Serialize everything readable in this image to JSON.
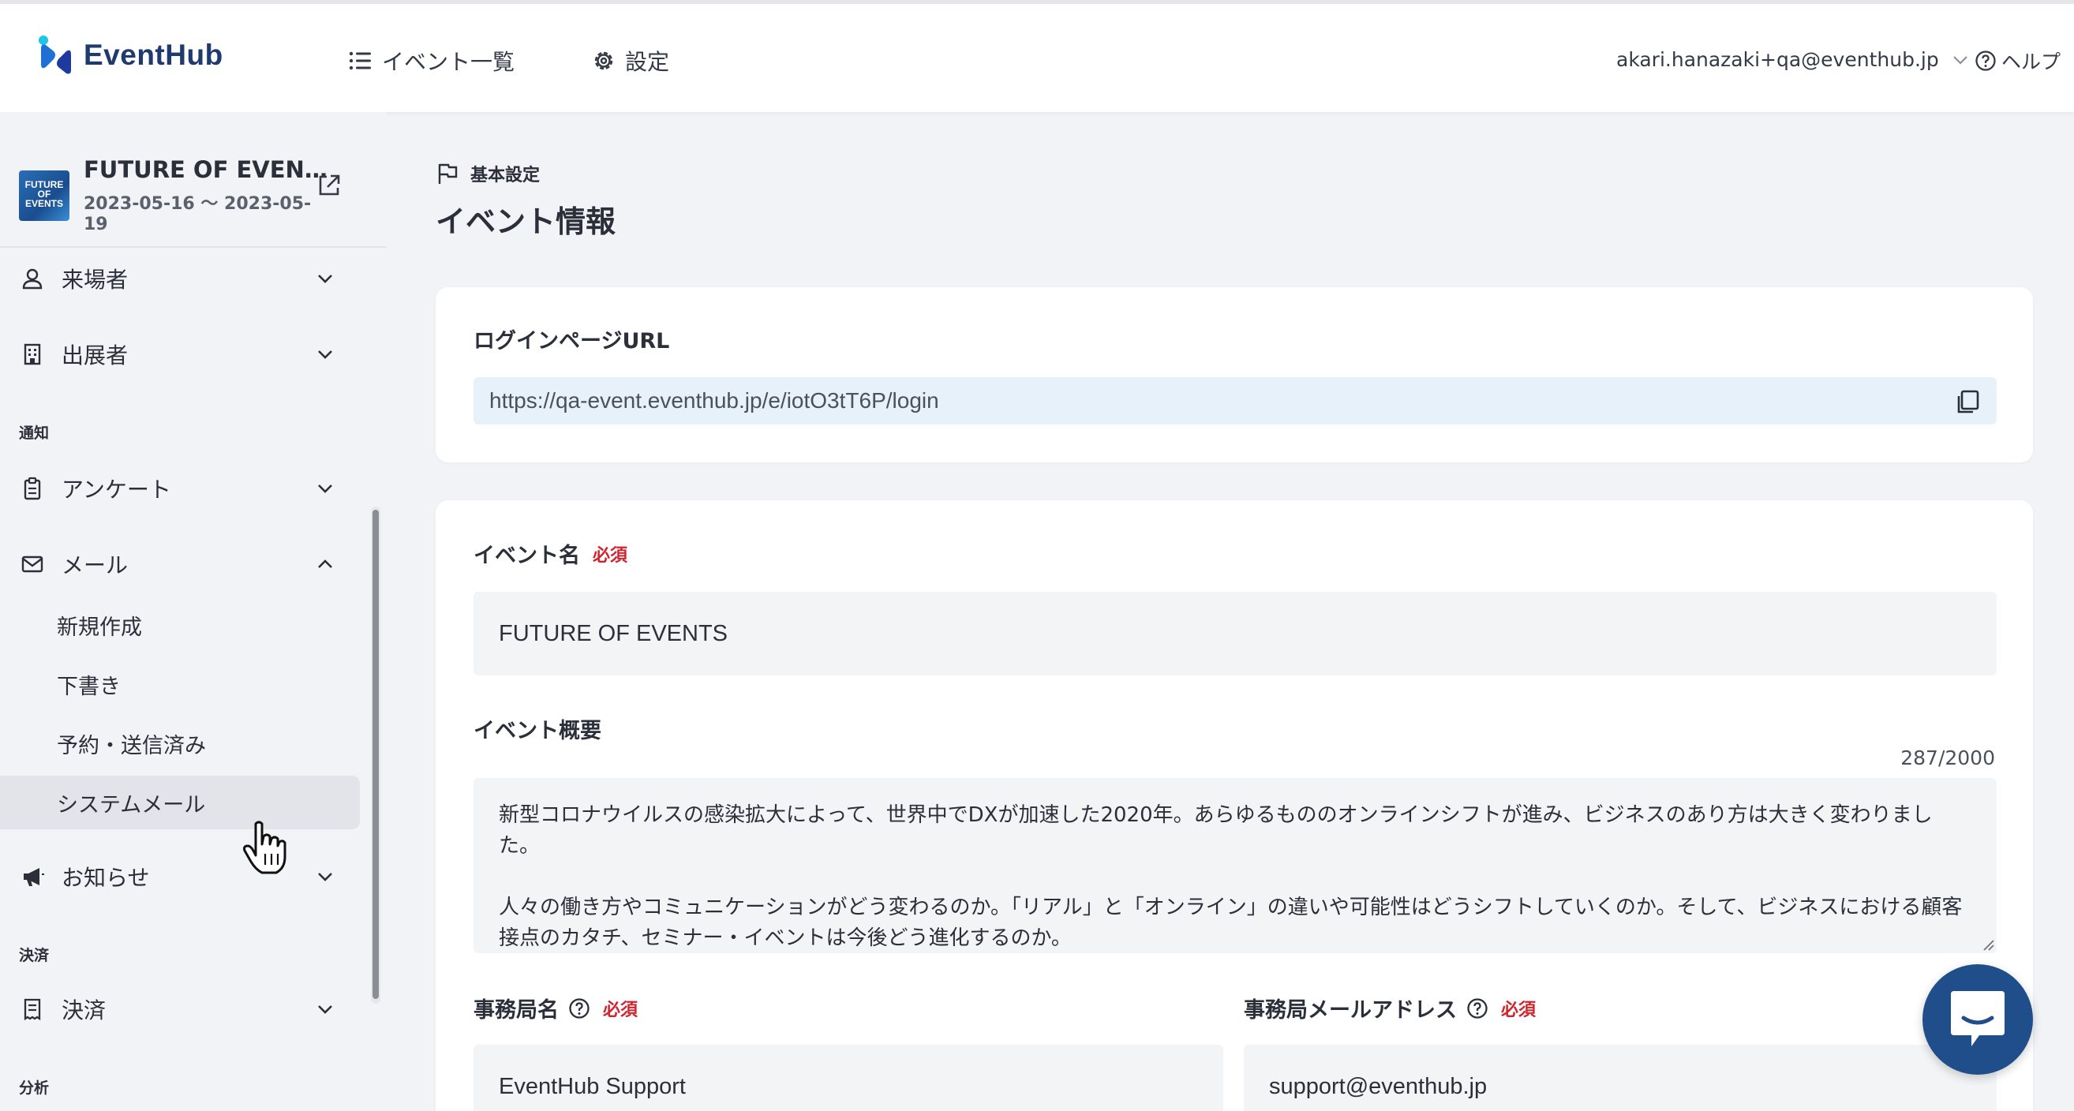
{
  "header": {
    "logo_text": "EventHub",
    "nav": [
      {
        "label": "イベント一覧",
        "icon": "list-icon"
      },
      {
        "label": "設定",
        "icon": "gear-icon"
      }
    ],
    "user_email": "akari.hanazaki+qa@eventhub.jp",
    "help_label": "ヘルプ"
  },
  "sidebar": {
    "event": {
      "thumb_text": "FUTURE OF EVENTS",
      "name": "FUTURE OF EVENTS",
      "dates": "2023-05-16 〜 2023-05-19"
    },
    "items": [
      {
        "label": "来場者",
        "icon": "person-icon",
        "expanded": false
      },
      {
        "label": "出展者",
        "icon": "building-icon",
        "expanded": false
      }
    ],
    "section_notice": "通知",
    "notice_items": [
      {
        "label": "アンケート",
        "icon": "clipboard-icon",
        "expanded": false
      },
      {
        "label": "メール",
        "icon": "mail-icon",
        "expanded": true
      }
    ],
    "mail_subitems": [
      "新規作成",
      "下書き",
      "予約・送信済み",
      "システムメール"
    ],
    "active_subitem": "システムメール",
    "news_item": {
      "label": "お知らせ",
      "icon": "megaphone-icon",
      "expanded": false
    },
    "section_payment": "決済",
    "payment_item": {
      "label": "決済",
      "icon": "receipt-icon",
      "expanded": false
    },
    "section_analytics": "分析"
  },
  "main": {
    "breadcrumb": "基本設定",
    "title": "イベント情報",
    "login_url": {
      "label": "ログインページURL",
      "value": "https://qa-event.eventhub.jp/e/iotO3tT6P/login"
    },
    "event_name": {
      "label": "イベント名",
      "required": "必須",
      "value": "FUTURE OF EVENTS"
    },
    "event_summary": {
      "label": "イベント概要",
      "counter": "287/2000",
      "paragraphs": [
        "新型コロナウイルスの感染拡大によって、世界中でDXが加速した2020年。あらゆるもののオンラインシフトが進み、ビジネスのあり方は大きく変わりました。",
        "人々の働き方やコミュニケーションがどう変わるのか。「リアル」と「オンライン」の違いや可能性はどうシフトしていくのか。そして、ビジネスにおける顧客接点のカタチ、セミナー・イベントは今後どう進化するのか。"
      ]
    },
    "office_name": {
      "label": "事務局名",
      "required": "必須",
      "value": "EventHub Support"
    },
    "office_email": {
      "label": "事務局メールアドレス",
      "required": "必須",
      "value": "support@eventhub.jp"
    }
  },
  "colors": {
    "brand": "#1f3a6e",
    "required": "#d0252f",
    "url_bg": "#e6f1fa",
    "chat": "#1f4e8a"
  }
}
